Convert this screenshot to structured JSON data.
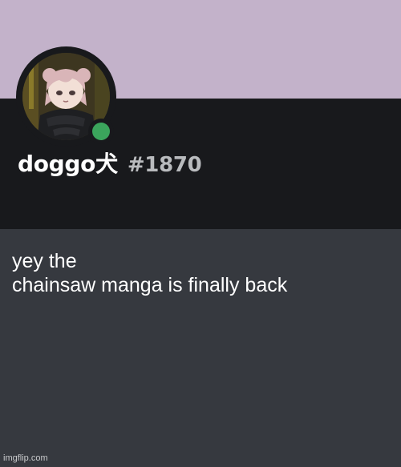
{
  "colors": {
    "banner": "#c3b2ca",
    "header_bg": "#18191c",
    "about_bg": "#36393f",
    "status_online": "#3ba55c"
  },
  "profile": {
    "username": "doggo犬",
    "discriminator": "#1870",
    "status": "online",
    "avatar_icon": "anime-avatar"
  },
  "message": {
    "text": "yey the\nchainsaw manga is finally back"
  },
  "watermark": {
    "text": "imgflip.com"
  }
}
